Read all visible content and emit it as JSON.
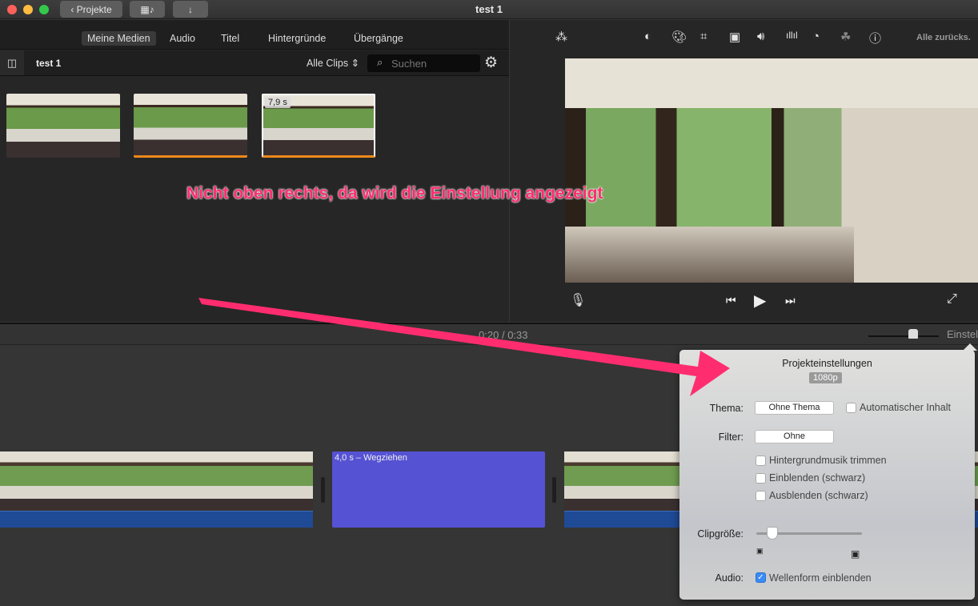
{
  "window": {
    "title": "test 1",
    "back_label": "Projekte"
  },
  "browser": {
    "tabs": [
      "Meine Medien",
      "Audio",
      "Titel",
      "Hintergründe",
      "Übergänge"
    ],
    "library_name": "test 1",
    "filter": "Alle Clips",
    "search_placeholder": "Suchen",
    "selected_clip_duration": "7,9 s"
  },
  "viewer": {
    "reset_all": "Alle zurücks.",
    "tools": [
      "magic-wand",
      "color-balance",
      "color-correction",
      "crop",
      "stabilization",
      "volume",
      "equalizer",
      "speed",
      "clip-filter",
      "info"
    ]
  },
  "timeline": {
    "current_time": "0:20",
    "separator": "/",
    "total_time": "0:33",
    "settings_label": "Einstel",
    "transition_clip": "4,0 s – Wegziehen"
  },
  "popover": {
    "title": "Projekteinstellungen",
    "resolution": "1080p",
    "theme_label": "Thema:",
    "theme_value": "Ohne Thema",
    "auto_content": "Automatischer Inhalt",
    "filter_label": "Filter:",
    "filter_value": "Ohne",
    "trim_music": "Hintergrundmusik trimmen",
    "fade_in": "Einblenden (schwarz)",
    "fade_out": "Ausblenden (schwarz)",
    "clip_size_label": "Clipgröße:",
    "clip_size_fraction": 0.15,
    "audio_label": "Audio:",
    "waveform": "Wellenform einblenden",
    "checks": {
      "auto_content": false,
      "trim_music": false,
      "fade_in": false,
      "fade_out": false,
      "waveform": true
    }
  },
  "annotation": {
    "text": "Nicht oben rechts, da wird die Einstellung angezeigt",
    "color": "#ff2d6f"
  }
}
